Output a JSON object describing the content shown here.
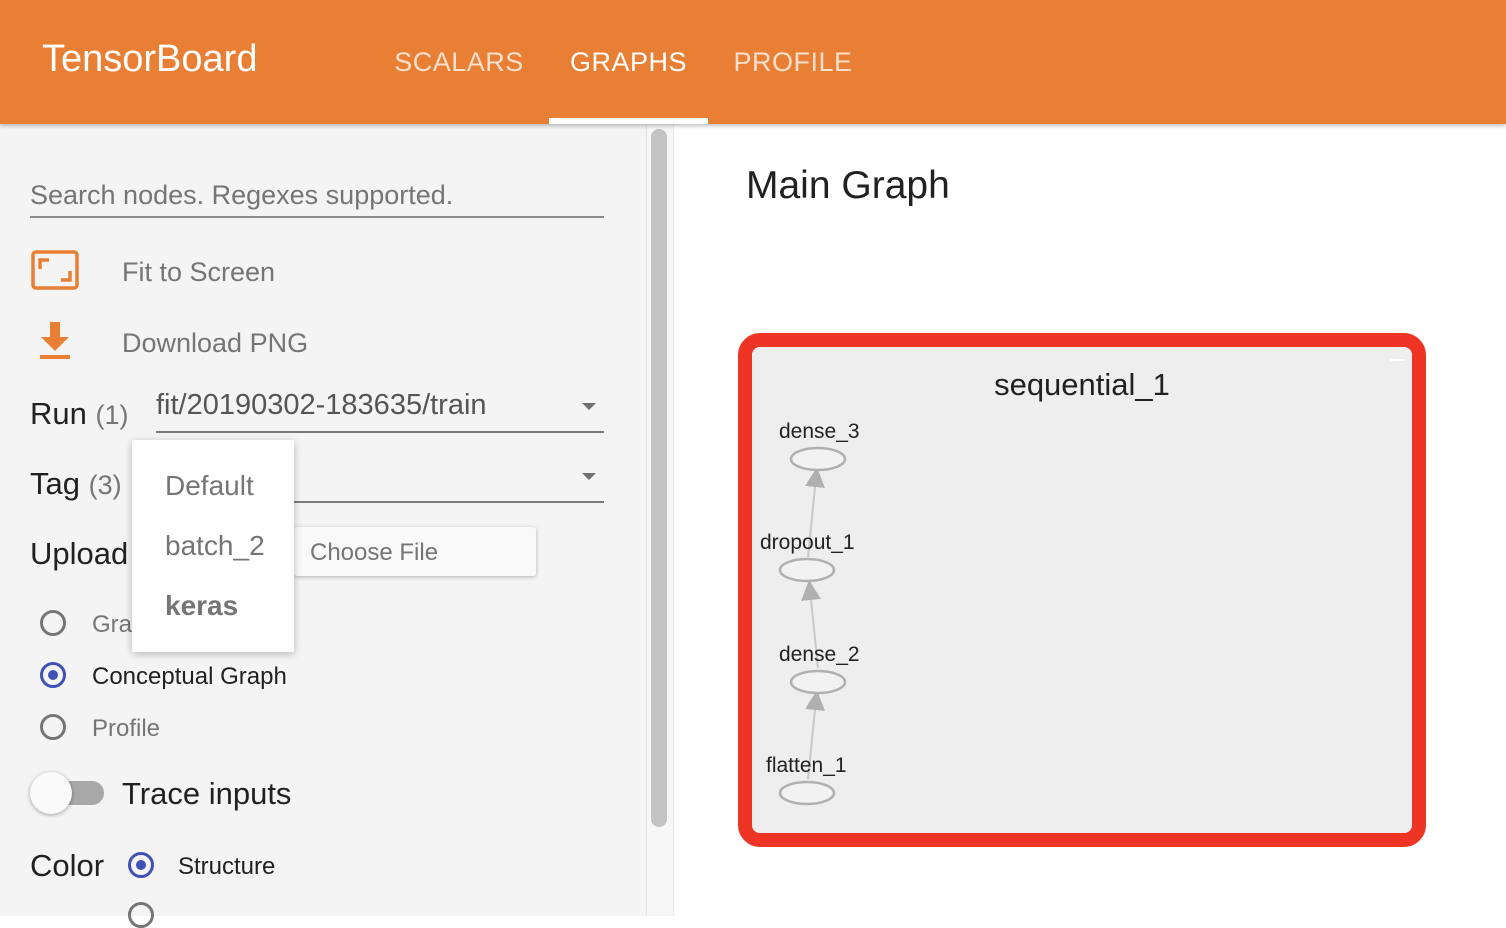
{
  "header": {
    "brand": "TensorBoard",
    "tabs": [
      {
        "label": "SCALARS",
        "active": false
      },
      {
        "label": "GRAPHS",
        "active": true
      },
      {
        "label": "PROFILE",
        "active": false
      }
    ],
    "accent_color": "#E87F34"
  },
  "sidebar": {
    "search_placeholder": "Search nodes. Regexes supported.",
    "fit_to_screen": "Fit to Screen",
    "download_png": "Download PNG",
    "run": {
      "label": "Run",
      "count": "(1)",
      "value": "fit/20190302-183635/train"
    },
    "tag": {
      "label": "Tag",
      "count": "(3)",
      "options": [
        "Default",
        "batch_2",
        "keras"
      ],
      "selected": "keras"
    },
    "upload": {
      "label": "Upload",
      "button": "Choose File"
    },
    "graph_type": [
      {
        "label": "Graph",
        "checked": false
      },
      {
        "label": "Conceptual Graph",
        "checked": true
      },
      {
        "label": "Profile",
        "checked": false
      }
    ],
    "trace_inputs": {
      "label": "Trace inputs",
      "on": false
    },
    "color": {
      "label": "Color",
      "options": [
        {
          "label": "Structure",
          "checked": true
        }
      ]
    }
  },
  "main": {
    "title": "Main Graph",
    "graph": {
      "name": "sequential_1",
      "nodes": [
        "dense_3",
        "dropout_1",
        "dense_2",
        "flatten_1"
      ],
      "highlight_color": "#EE3424"
    }
  }
}
